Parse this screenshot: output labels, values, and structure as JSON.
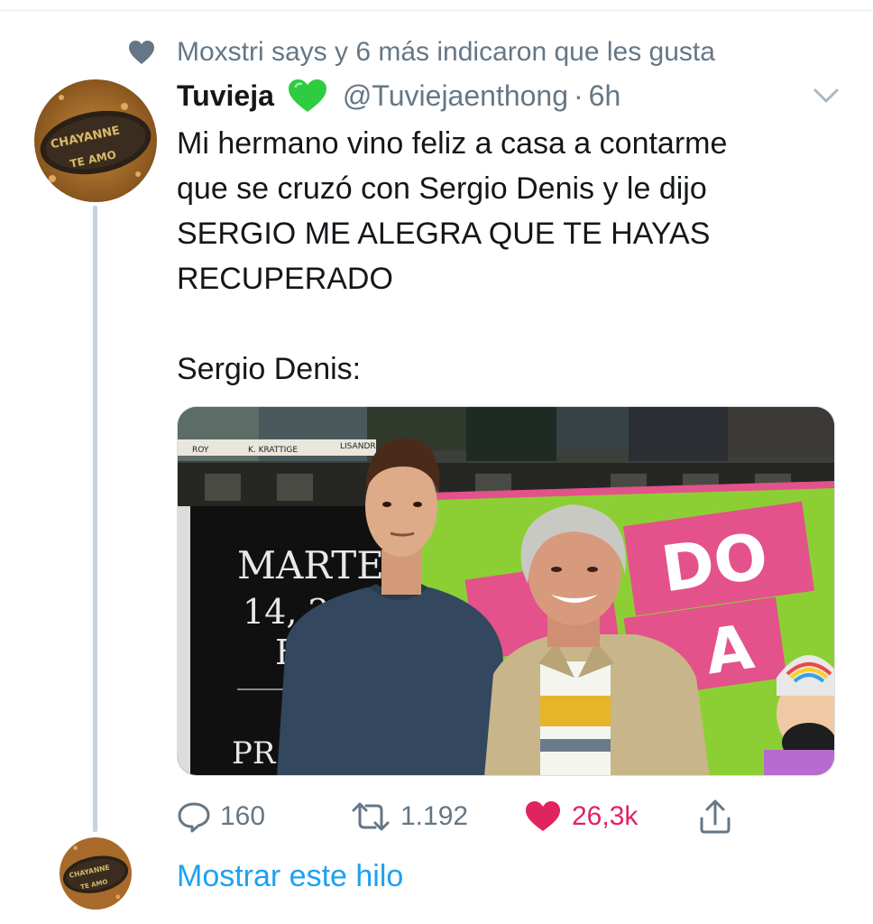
{
  "social_context": {
    "text": "Moxstri says y 6 más indicaron que les gusta"
  },
  "tweet": {
    "display_name": "Tuvieja",
    "handle": "@Tuviejaenthong",
    "separator": "·",
    "time": "6h",
    "text_lines": [
      "Mi hermano vino feliz a casa a contarme",
      "que se cruzó con Sergio Denis y le dijo",
      "SERGIO ME ALEGRA QUE TE HAYAS",
      "RECUPERADO",
      "Sergio Denis:"
    ],
    "actions": {
      "replies": "160",
      "retweets": "1.192",
      "likes": "26,3k"
    }
  },
  "photo_signs": {
    "martes": "MARTES",
    "dates": "14, 21",
    "e": "E",
    "pr": "PR",
    "banner_word_1": "DO",
    "banner_word_2": "A",
    "top_labels": [
      "ROY",
      "K. KRATTIGE",
      "LISANDR"
    ]
  },
  "avatar_text": {
    "line1": "CHAYANNE",
    "line2": "TE AMO"
  },
  "show_thread": "Mostrar este hilo",
  "colors": {
    "like_red": "#e0245e",
    "link_blue": "#1da1f2",
    "muted": "#657786",
    "heart_green": "#2ecc40"
  }
}
